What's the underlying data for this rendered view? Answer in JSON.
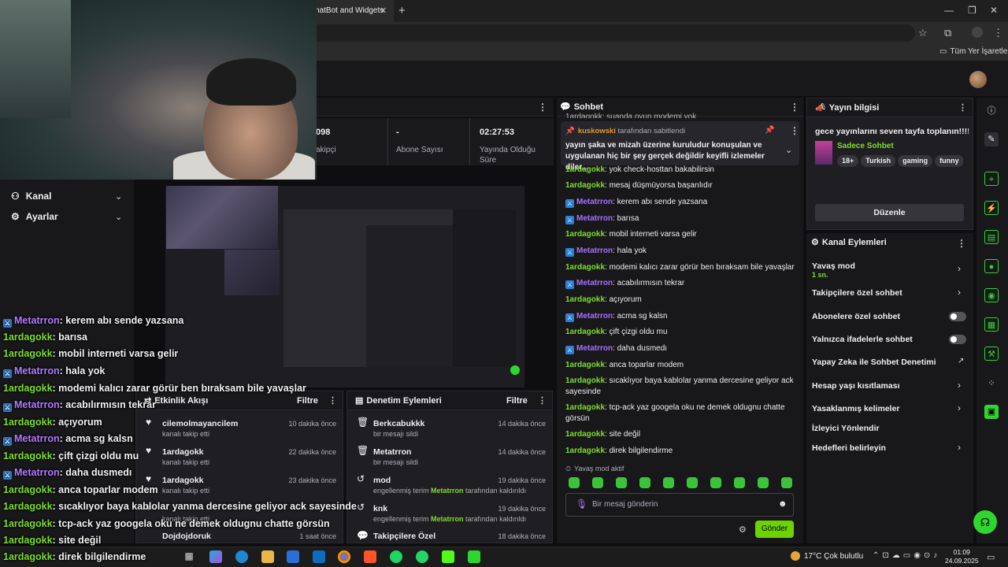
{
  "browser": {
    "tab_title": "hatBot and Widgets",
    "bookmarks_label": "Tüm Yer İşaretleri"
  },
  "stats": [
    {
      "value": "098",
      "label": "akipçi"
    },
    {
      "value": "-",
      "label": "Abone Sayısı"
    },
    {
      "value": "02:27:53",
      "label": "Yayında Olduğu Süre"
    }
  ],
  "nav": {
    "channel": "Kanal",
    "settings": "Ayarlar"
  },
  "overlay_chat": [
    {
      "user": "Metatrron",
      "text": ": kerem abı sende yazsana",
      "v": true
    },
    {
      "user": "1ardagokk",
      "text": ": barısa",
      "v": false
    },
    {
      "user": "1ardagokk",
      "text": ": mobil interneti varsa gelir",
      "v": false
    },
    {
      "user": "Metatrron",
      "text": ": hala yok",
      "v": true
    },
    {
      "user": "1ardagokk",
      "text": ": modemi kalıcı zarar görür ben bıraksam bile yavaşlar",
      "v": false
    },
    {
      "user": "Metatrron",
      "text": ": acabılırmısın tekrar",
      "v": true
    },
    {
      "user": "1ardagokk",
      "text": ": açıyorum",
      "v": false
    },
    {
      "user": "Metatrron",
      "text": ": acma sg kalsn",
      "v": true
    },
    {
      "user": "1ardagokk",
      "text": ": çift çizgi oldu mu",
      "v": false
    },
    {
      "user": "Metatrron",
      "text": ": daha dusmedı",
      "v": true
    },
    {
      "user": "1ardagokk",
      "text": ": anca toparlar modem",
      "v": false
    },
    {
      "user": "1ardagokk",
      "text": ": sıcaklıyor baya kablolar yanma dercesine geliyor ack sayesinde",
      "v": false
    },
    {
      "user": "1ardagokk",
      "text": ": tcp-ack yaz googela oku ne demek oldugnu chatte görsün",
      "v": false
    },
    {
      "user": "1ardagokk",
      "text": ": site değil",
      "v": false
    },
    {
      "user": "1ardagokk",
      "text": ": direk bilgilendirme",
      "v": false
    }
  ],
  "feed": {
    "title": "Etkinlik Akışı",
    "filter": "Filtre",
    "items": [
      {
        "name": "cilemolmayancilem",
        "sub": "kanalı takip etti",
        "time": "10 dakika önce"
      },
      {
        "name": "1ardagokk",
        "sub": "kanalı takip etti",
        "time": "22 dakika önce"
      },
      {
        "name": "1ardagokk",
        "sub": "kanalı takip etti",
        "time": "23 dakika önce"
      },
      {
        "name": "",
        "sub": "kanalı takip etti",
        "time": ""
      },
      {
        "name": "Dojdojdoruk",
        "sub": "",
        "time": "1 saat önce"
      }
    ]
  },
  "mod": {
    "title": "Denetim Eylemleri",
    "filter": "Filtre",
    "items": [
      {
        "name": "Berkcabukkk",
        "sub": "bir mesajı sildi",
        "time": "14 dakika önce"
      },
      {
        "name": "Metatrron",
        "sub": "bir mesajı sildi",
        "time": "14 dakika önce"
      },
      {
        "name": "mod",
        "sub_a": "engellenmiş terim ",
        "sub_u": "Metatrron",
        "sub_b": " tarafından kaldırıldı",
        "time": "19 dakika önce"
      },
      {
        "name": "knk",
        "sub_a": "engellenmiş terim ",
        "sub_u": "Metatrron",
        "sub_b": " tarafından kaldırıldı",
        "time": "19 dakika önce"
      },
      {
        "name": "Takipçilere Özel",
        "time": "18 dakika önce"
      }
    ]
  },
  "chat": {
    "title": "Sohbet",
    "partial_top": "1ardagokk: suanda oyun modemi yok",
    "pinned_user": "kuskowski",
    "pinned_by": " tarafından sabitlendi",
    "pinned_text": "yayın şaka ve mizah üzerine kuruludur konuşulan ve uygulanan hiç bir şey gerçek değildir keyifli izlemeler diler...",
    "messages": [
      {
        "user": "1ardagokk",
        "text": ": yok check-hosttan bakabilirsin",
        "v": false
      },
      {
        "user": "1ardagokk",
        "text": ": mesaj düşmüyorsa başarılıdır",
        "v": false
      },
      {
        "user": "Metatrron",
        "text": ": kerem abı sende yazsana",
        "v": true
      },
      {
        "user": "Metatrron",
        "text": ": barısa",
        "v": true
      },
      {
        "user": "1ardagokk",
        "text": ": mobil interneti varsa gelir",
        "v": false
      },
      {
        "user": "Metatrron",
        "text": ": hala yok",
        "v": true
      },
      {
        "user": "1ardagokk",
        "text": ": modemi kalıcı zarar görür ben bıraksam bile yavaşlar",
        "v": false
      },
      {
        "user": "Metatrron",
        "text": ": acabılırmısın tekrar",
        "v": true
      },
      {
        "user": "1ardagokk",
        "text": ": açıyorum",
        "v": false
      },
      {
        "user": "Metatrron",
        "text": ": acma sg kalsn",
        "v": true
      },
      {
        "user": "1ardagokk",
        "text": ": çift çizgi oldu mu",
        "v": false
      },
      {
        "user": "Metatrron",
        "text": ": daha dusmedı",
        "v": true
      },
      {
        "user": "1ardagokk",
        "text": ": anca toparlar modem",
        "v": false
      },
      {
        "user": "1ardagokk",
        "text": ": sıcaklıyor baya kablolar yanma dercesine geliyor ack sayesinde",
        "v": false
      },
      {
        "user": "1ardagokk",
        "text": ": tcp-ack yaz googela oku ne demek oldugnu chatte görsün",
        "v": false
      },
      {
        "user": "1ardagokk",
        "text": ": site değil",
        "v": false
      },
      {
        "user": "1ardagokk",
        "text": ": direk bilgilendirme",
        "v": false
      }
    ],
    "slow_mode": "Yavaş mod aktif",
    "placeholder": "Bir mesaj gönderin",
    "send": "Gönder"
  },
  "info": {
    "title": "Yayın bilgisi",
    "stream_title": "gece yayınlarını seven tayfa toplanın!!!!",
    "category": "Sadece Sohbet",
    "tags": [
      "18+",
      "Turkish",
      "gaming",
      "funny"
    ],
    "edit": "Düzenle"
  },
  "actions": {
    "title": "Kanal Eylemleri",
    "slow": "Yavaş mod",
    "slow_val": "1 sn.",
    "followers": "Takipçilere özel sohbet",
    "subs": "Abonelere özel sohbet",
    "emotes": "Yalnızca ifadelerle sohbet",
    "ai": "Yapay Zeka ile Sohbet Denetimi",
    "age": "Hesap yaşı kısıtlaması",
    "banned": "Yasaklanmış kelimeler",
    "redirect": "İzleyici Yönlendir",
    "goals": "Hedefleri belirleyin"
  },
  "taskbar": {
    "weather": "17°C  Çok bulutlu",
    "time": "01:09",
    "date": "24.09.2025"
  }
}
